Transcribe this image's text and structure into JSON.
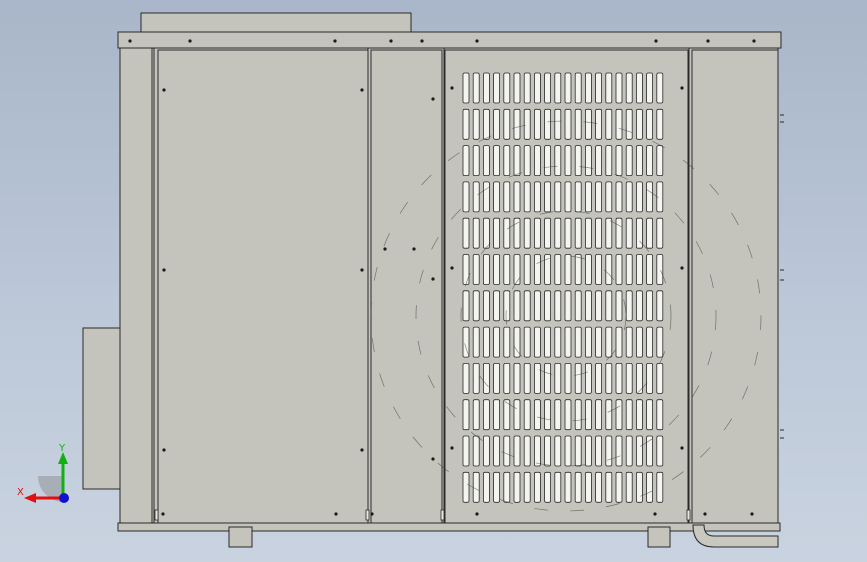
{
  "view": {
    "background_top": "#a9b6c9",
    "background_bottom": "#c9d3e0",
    "part_fill": "#c4c4bc",
    "edge_color": "#2a2a2a"
  },
  "triad": {
    "x_label": "X",
    "y_label": "Y",
    "x_color": "#e01010",
    "y_color": "#10b010",
    "z_color": "#1010d0"
  },
  "grille": {
    "rows": 12,
    "cols": 20
  }
}
